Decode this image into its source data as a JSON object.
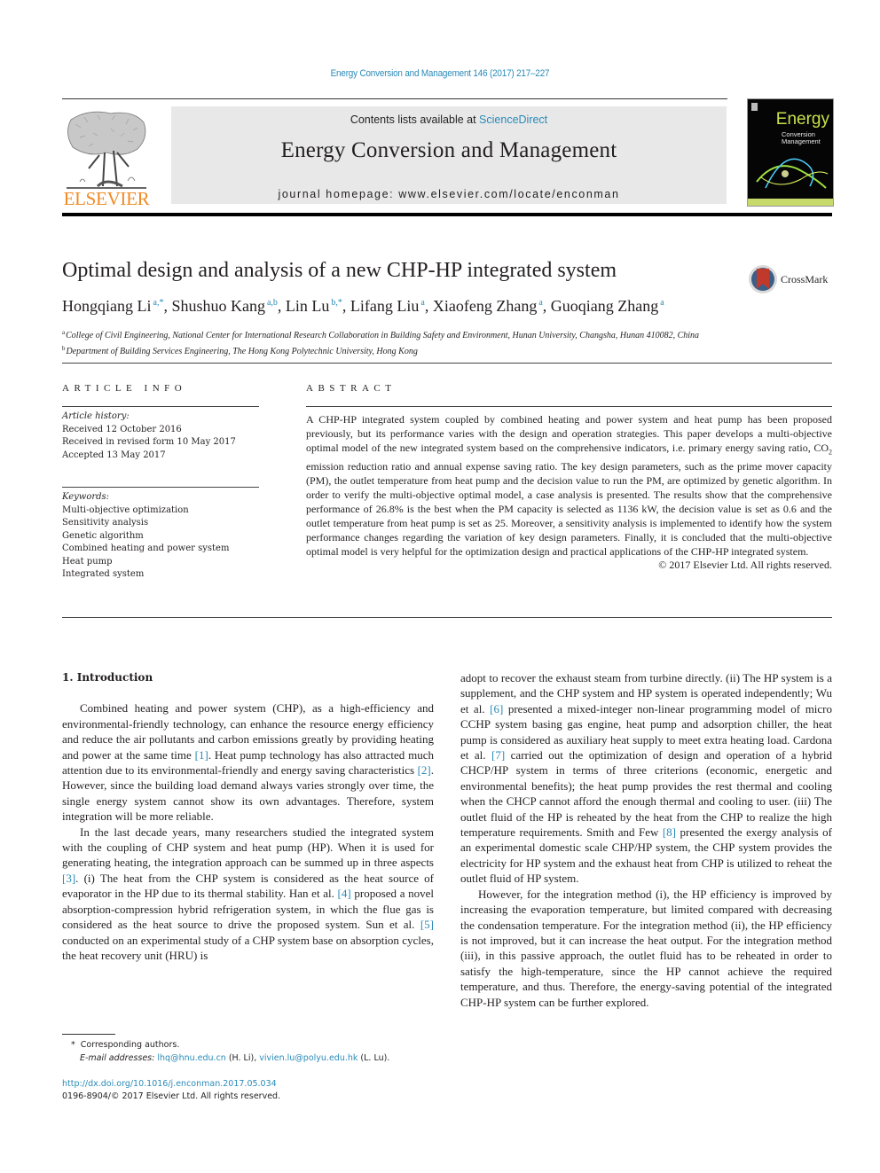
{
  "header": {
    "running_head": "Energy Conversion and Management 146 (2017) 217–227",
    "contents_prefix": "Contents lists available at ",
    "contents_link": "ScienceDirect",
    "journal_title": "Energy Conversion and Management",
    "homepage": "journal homepage: www.elsevier.com/locate/enconman",
    "publisher_logo_text": "ELSEVIER",
    "cover": {
      "title": "Energy",
      "subtitle_line1": "Conversion",
      "subtitle_line2": "Management"
    },
    "colors": {
      "link": "#2a8ab8",
      "elsevier_orange": "#f08a24",
      "masthead_bg": "#e8e8e8"
    }
  },
  "article": {
    "title": "Optimal design and analysis of a new CHP-HP integrated system",
    "crossmark_label": "CrossMark",
    "authors": [
      {
        "name": "Hongqiang Li",
        "sup": "a,*"
      },
      {
        "name": "Shushuo Kang",
        "sup": "a,b"
      },
      {
        "name": "Lin Lu",
        "sup": "b,*"
      },
      {
        "name": "Lifang Liu",
        "sup": "a"
      },
      {
        "name": "Xiaofeng Zhang",
        "sup": "a"
      },
      {
        "name": "Guoqiang Zhang",
        "sup": "a"
      }
    ],
    "affiliations": [
      {
        "key": "a",
        "text": "College of Civil Engineering, National Center for International Research Collaboration in Building Safety and Environment, Hunan University, Changsha, Hunan 410082, China"
      },
      {
        "key": "b",
        "text": "Department of Building Services Engineering, The Hong Kong Polytechnic University, Hong Kong"
      }
    ]
  },
  "article_info": {
    "heading": "ARTICLE INFO",
    "history_label": "Article history:",
    "history": [
      "Received 12 October 2016",
      "Received in revised form 10 May 2017",
      "Accepted 13 May 2017"
    ],
    "keywords_label": "Keywords:",
    "keywords": [
      "Multi-objective optimization",
      "Sensitivity analysis",
      "Genetic algorithm",
      "Combined heating and power system",
      "Heat pump",
      "Integrated system"
    ]
  },
  "abstract": {
    "heading": "ABSTRACT",
    "text_part1": "A CHP-HP integrated system coupled by combined heating and power system and heat pump has been proposed previously, but its performance varies with the design and operation strategies. This paper develops a multi-objective optimal model of the new integrated system based on the comprehensive indicators, i.e. primary energy saving ratio, CO",
    "text_sub": "2",
    "text_part2": " emission reduction ratio and annual expense saving ratio. The key design parameters, such as the prime mover capacity (PM), the outlet temperature from heat pump and the decision value to run the PM, are optimized by genetic algorithm. In order to verify the multi-objective optimal model, a case analysis is presented. The results show that the comprehensive performance of 26.8% is the best when the PM capacity is selected as 1136 kW, the decision value is set as 0.6 and the outlet temperature from heat pump is set as 25. Moreover, a sensitivity analysis is implemented to identify how the system performance changes regarding the variation of key design parameters. Finally, it is concluded that the multi-objective optimal model is very helpful for the optimization design and practical applications of the CHP-HP integrated system.",
    "copyright": "© 2017 Elsevier Ltd. All rights reserved."
  },
  "body": {
    "section_heading": "1. Introduction",
    "left": {
      "p1": [
        "Combined heating and power system (CHP), as a high-efficiency and environmental-friendly technology, can enhance the resource energy efficiency and reduce the air pollutants and carbon emissions greatly by providing heating and power at the same time ",
        "[1]",
        ". Heat pump technology has also attracted much attention due to its environmental-friendly and energy saving characteristics ",
        "[2]",
        ". However, since the building load demand always varies strongly over time, the single energy system cannot show its own advantages. Therefore, system integration will be more reliable."
      ],
      "p2": [
        "In the last decade years, many researchers studied the integrated system with the coupling of CHP system and heat pump (HP). When it is used for generating heating, the integration approach can be summed up in three aspects ",
        "[3]",
        ". (i) The heat from the CHP system is considered as the heat source of evaporator in the HP due to its thermal stability. Han et al. ",
        "[4]",
        " proposed a novel absorption-compression hybrid refrigeration system, in which the flue gas is considered as the heat source to drive the proposed system. Sun et al. ",
        "[5]",
        " conducted on an experimental study of a CHP system base on absorption cycles, the heat recovery unit (HRU) is"
      ]
    },
    "right": {
      "p1": [
        "adopt to recover the exhaust steam from turbine directly. (ii) The HP system is a supplement, and the CHP system and HP system is operated independently; Wu et al. ",
        "[6]",
        " presented a mixed-integer non-linear programming model of micro CCHP system basing gas engine, heat pump and adsorption chiller, the heat pump is considered as auxiliary heat supply to meet extra heating load. Cardona et al. ",
        "[7]",
        " carried out the optimization of design and operation of a hybrid CHCP/HP system in terms of three criterions (economic, energetic and environmental benefits); the heat pump provides the rest thermal and cooling when the CHCP cannot afford the enough thermal and cooling to user. (iii) The outlet fluid of the HP is reheated by the heat from the CHP to realize the high temperature requirements. Smith and Few ",
        "[8]",
        " presented the exergy analysis of an experimental domestic scale CHP/HP system, the CHP system provides the electricity for HP system and the exhaust heat from CHP is utilized to reheat the outlet fluid of HP system."
      ],
      "p2": "However, for the integration method (i), the HP efficiency is improved by increasing the evaporation temperature, but limited compared with decreasing the condensation temperature. For the integration method (ii), the HP efficiency is not improved, but it can increase the heat output. For the integration method (iii), in this passive approach, the outlet fluid has to be reheated in order to satisfy the high-temperature, since the HP cannot achieve the required temperature, and thus. Therefore, the energy-saving potential of the integrated CHP-HP system can be further explored."
    }
  },
  "footnotes": {
    "corresponding_mark": "*",
    "corresponding": "Corresponding authors.",
    "email_label": "E-mail addresses:",
    "email1": "lhq@hnu.edu.cn",
    "email1_owner": " (H. Li), ",
    "email2": "vivien.lu@polyu.edu.hk",
    "email2_owner": " (L. Lu).",
    "doi": "http://dx.doi.org/10.1016/j.enconman.2017.05.034",
    "issn": "0196-8904/© 2017 Elsevier Ltd. All rights reserved."
  }
}
